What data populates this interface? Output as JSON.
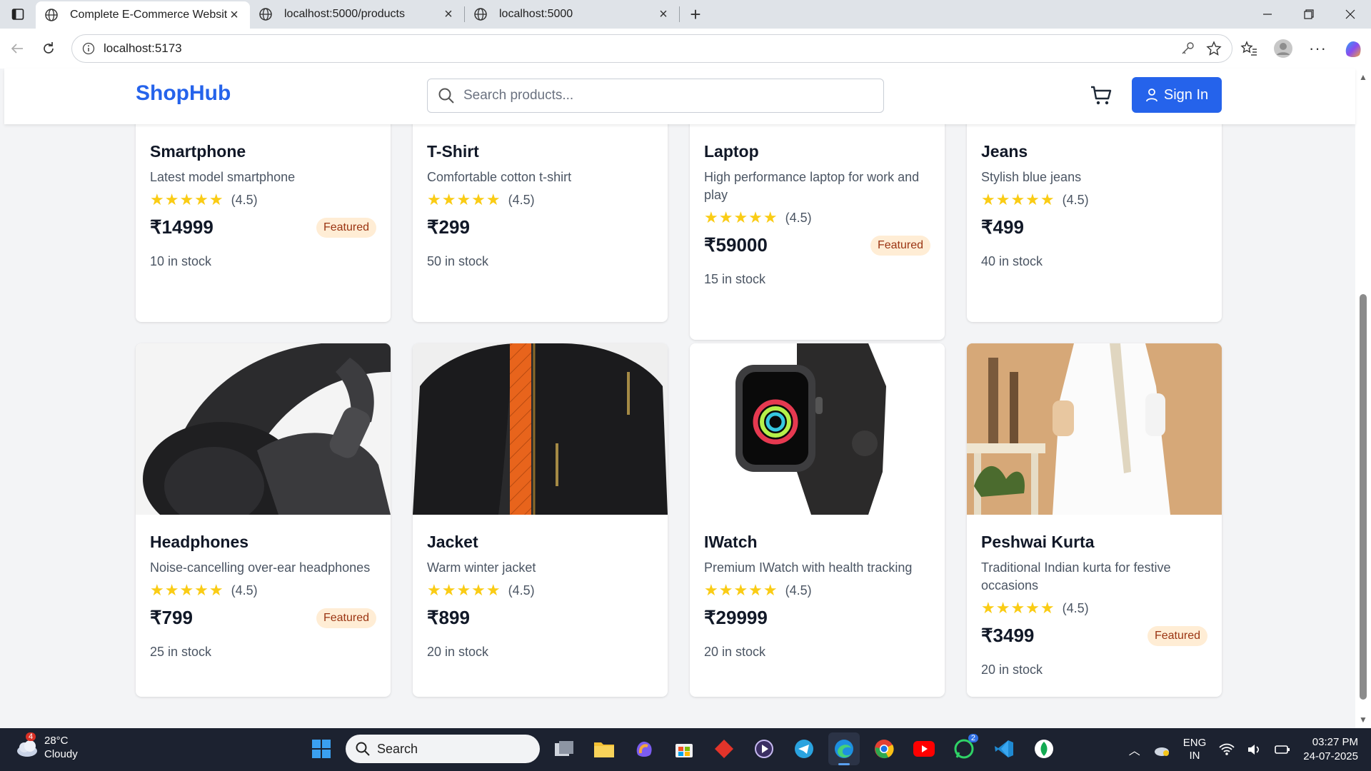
{
  "browser": {
    "tabs": [
      {
        "title": "Complete E-Commerce Website",
        "active": true
      },
      {
        "title": "localhost:5000/products",
        "active": false
      },
      {
        "title": "localhost:5000",
        "active": false
      }
    ],
    "url": "localhost:5173"
  },
  "header": {
    "logo": "ShopHub",
    "search_placeholder": "Search products...",
    "signin_label": "Sign In"
  },
  "products": [
    {
      "name": "Smartphone",
      "description": "Latest model smartphone",
      "stars": "★★★★★",
      "rating": "(4.5)",
      "price": "₹14999",
      "badge": "Featured",
      "stock": "10 in stock"
    },
    {
      "name": "T-Shirt",
      "description": "Comfortable cotton t-shirt",
      "stars": "★★★★★",
      "rating": "(4.5)",
      "price": "₹299",
      "badge": "",
      "stock": "50 in stock"
    },
    {
      "name": "Laptop",
      "description": "High performance laptop for work and play",
      "stars": "★★★★★",
      "rating": "(4.5)",
      "price": "₹59000",
      "badge": "Featured",
      "stock": "15 in stock"
    },
    {
      "name": "Jeans",
      "description": "Stylish blue jeans",
      "stars": "★★★★★",
      "rating": "(4.5)",
      "price": "₹499",
      "badge": "",
      "stock": "40 in stock"
    },
    {
      "name": "Headphones",
      "description": "Noise-cancelling over-ear headphones",
      "stars": "★★★★★",
      "rating": "(4.5)",
      "price": "₹799",
      "badge": "Featured",
      "stock": "25 in stock"
    },
    {
      "name": "Jacket",
      "description": "Warm winter jacket",
      "stars": "★★★★★",
      "rating": "(4.5)",
      "price": "₹899",
      "badge": "",
      "stock": "20 in stock"
    },
    {
      "name": "IWatch",
      "description": "Premium IWatch with health tracking",
      "stars": "★★★★★",
      "rating": "(4.5)",
      "price": "₹29999",
      "badge": "",
      "stock": "20 in stock"
    },
    {
      "name": "Peshwai Kurta",
      "description": "Traditional Indian kurta for festive occasions",
      "stars": "★★★★★",
      "rating": "(4.5)",
      "price": "₹3499",
      "badge": "Featured",
      "stock": "20 in stock"
    }
  ],
  "taskbar": {
    "weather_temp": "28°C",
    "weather_desc": "Cloudy",
    "weather_badge": "4",
    "search_label": "Search",
    "whatsapp_badge": "2",
    "lang_line1": "ENG",
    "lang_line2": "IN",
    "time": "03:27 PM",
    "date": "24-07-2025"
  },
  "colors": {
    "brand": "#2563eb",
    "star": "#facc15",
    "badge_bg": "#ffedd5",
    "badge_text": "#9a3412"
  }
}
